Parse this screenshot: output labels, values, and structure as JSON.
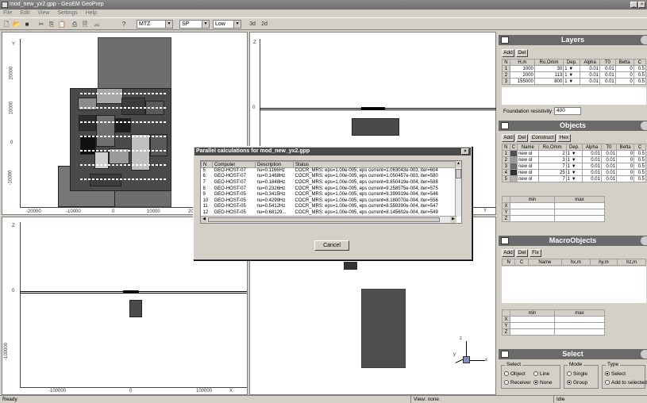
{
  "window": {
    "title": "mod_new_yx2.gpp - GeoEM GeoPrep"
  },
  "menu": [
    "File",
    "Edit",
    "View",
    "Settings",
    "Help"
  ],
  "toolbar": {
    "combo1": "MTZ",
    "combo2": "SP",
    "combo3": "Low",
    "btn3d": "3d",
    "btn2d": "2d"
  },
  "views": {
    "top_left": {
      "y_label": "Y",
      "x_label": "X",
      "y_ticks": [
        "20000",
        "10000",
        "0",
        "-10000"
      ],
      "x_ticks": [
        "-20000",
        "-10000",
        "0",
        "10000",
        "20"
      ]
    },
    "top_right": {
      "z_label": "Z",
      "y_label": "Y",
      "zero_tick": "0"
    },
    "bottom_left": {
      "z_label": "Z",
      "x_label": "X",
      "zero_tick": "0",
      "z_tick": "-100000",
      "x_ticks": [
        "-100000",
        "0",
        "100000"
      ]
    },
    "axes3d": {
      "z": "z",
      "y": "y",
      "x": "x"
    }
  },
  "layers": {
    "title": "Layers",
    "add": "Add",
    "del": "Del",
    "columns": [
      "N",
      "H,m",
      "Ro,Omm",
      "Dep.",
      "Alpha",
      "T0",
      "Betta",
      "C"
    ],
    "rows": [
      [
        "1",
        "1000",
        "30",
        "1",
        "0.01",
        "0.01",
        "0",
        "0.5"
      ],
      [
        "2",
        "2000",
        "113",
        "1",
        "0.01",
        "0.01",
        "0",
        "0.5"
      ],
      [
        "3",
        "155000",
        "800",
        "1",
        "0.01",
        "0.01",
        "0",
        "0.5"
      ]
    ],
    "foundation_label": "Foundation resistivity",
    "foundation_value": "400"
  },
  "objects": {
    "title": "Objects",
    "buttons": [
      "Add",
      "Del",
      "Construct",
      "Hex"
    ],
    "columns": [
      "N",
      "C",
      "Name",
      "Ro,Omm",
      "Dep.",
      "Alpha",
      "T0",
      "Betta",
      "C"
    ],
    "rows": [
      [
        "1",
        "#505050",
        "new ol",
        "2",
        "1",
        "0.01",
        "0.01",
        "0",
        "0.5"
      ],
      [
        "2",
        "#9a9a9a",
        "new ol",
        "3",
        "1",
        "0.01",
        "0.01",
        "0",
        "0.5"
      ],
      [
        "3",
        "#6c6c6c",
        "new ol",
        "7",
        "1",
        "0.01",
        "0.01",
        "0",
        "0.5"
      ],
      [
        "4",
        "#303030",
        "new ol",
        "25",
        "1",
        "0.01",
        "0.01",
        "0",
        "0.5"
      ],
      [
        "5",
        "#b0b0b0",
        "new ol",
        "7",
        "1",
        "0.01",
        "0.01",
        "0",
        "0.5"
      ]
    ],
    "minmax": {
      "min": "min",
      "max": "max",
      "rows": [
        "X",
        "Y",
        "Z"
      ]
    }
  },
  "macro": {
    "title": "MacroObjects",
    "buttons": [
      "Add",
      "Del",
      "Fix"
    ],
    "columns": [
      "N",
      "C",
      "Name",
      "hx,m",
      "hy,m",
      "hz,m"
    ],
    "minmax": {
      "min": "min",
      "max": "max",
      "rows": [
        "X",
        "Y",
        "Z"
      ]
    }
  },
  "select": {
    "title": "Select",
    "group_select": "Select",
    "object": "Object",
    "line": "Line",
    "receiver": "Receiver",
    "none": "None",
    "group_mode": "Mode",
    "single": "Single",
    "group": "Group",
    "group_type": "Type",
    "type_select": "Select",
    "add_to_selected": "Add to selected"
  },
  "dialog": {
    "title": "Parallel calculations for mod_new_yx2.gpp",
    "columns": [
      "N",
      "Computer",
      "Description",
      "Status"
    ],
    "rows": [
      [
        "5",
        "GEO-HOST-07",
        "nu=0.1166Hz",
        "COCR_MRS: eps=1.00e-005, eps current=1.063043e-003, iter=604"
      ],
      [
        "6",
        "GEO-HOST-07",
        "nu=0.1468Hz",
        "COCR_MRS: eps=1.00e-005, eps current=1.050457e-003, iter=580"
      ],
      [
        "7",
        "GEO-HOST-07",
        "nu=0.1848Hz",
        "COCR_MRS: eps=1.00e-005, eps current=9.850419e-004, iter=588"
      ],
      [
        "8",
        "GEO-HOST-07",
        "nu=0.2326Hz",
        "COCR_MRS: eps=1.00e-005, eps current=9.258575e-004, iter=575"
      ],
      [
        "9",
        "GEO-HOST-05",
        "nu=0.3415Hz",
        "COCR_MRS: eps=1.00e-005, eps current=9.399919e-004, iter=546"
      ],
      [
        "10",
        "GEO-HOST-05",
        "nu=0.4299Hz",
        "COCR_MRS: eps=1.00e-005, eps current=8.180070e-004, iter=556"
      ],
      [
        "11",
        "GEO-HOST-05",
        "nu=0.5412Hz",
        "COCR_MRS: eps=1.00e-005, eps current=8.559390e-004, iter=547"
      ],
      [
        "12",
        "GEO-HOST-05",
        "nu=0.68129...",
        "COCR_MRS: eps=1.00e-005, eps current=8.145602e-004, iter=549"
      ]
    ],
    "cancel": "Cancel"
  },
  "status": {
    "left": "Ready",
    "middle": "View: none",
    "right": "Idle"
  }
}
